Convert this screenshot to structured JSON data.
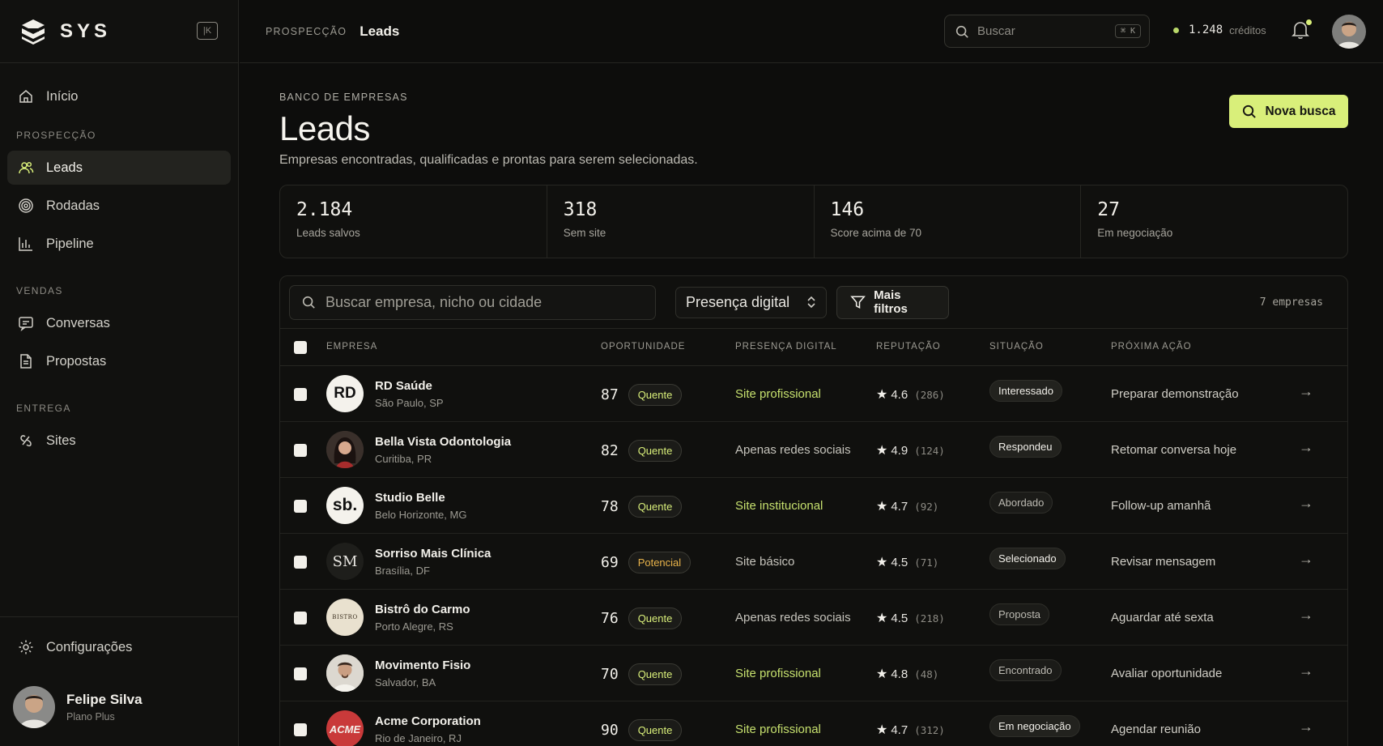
{
  "brand": {
    "name": "SYS"
  },
  "sidebar": {
    "home": "Início",
    "sections": [
      {
        "title": "PROSPECÇÃO",
        "items": [
          "Leads",
          "Rodadas",
          "Pipeline"
        ]
      },
      {
        "title": "VENDAS",
        "items": [
          "Conversas",
          "Propostas"
        ]
      },
      {
        "title": "ENTREGA",
        "items": [
          "Sites"
        ]
      }
    ],
    "settings": "Configurações",
    "user": {
      "name": "Felipe Silva",
      "plan": "Plano Plus"
    }
  },
  "topbar": {
    "section": "PROSPECÇÃO",
    "current": "Leads",
    "search_placeholder": "Buscar",
    "shortcut": "⌘ K",
    "credits_value": "1.248",
    "credits_label": "créditos"
  },
  "header": {
    "eyebrow": "BANCO DE EMPRESAS",
    "title": "Leads",
    "subtitle": "Empresas encontradas, qualificadas e prontas para serem selecionadas.",
    "new_button": "Nova busca"
  },
  "stats": [
    {
      "value": "2.184",
      "label": "Leads salvos"
    },
    {
      "value": "318",
      "label": "Sem site"
    },
    {
      "value": "146",
      "label": "Score acima de 70"
    },
    {
      "value": "27",
      "label": "Em negociação"
    }
  ],
  "toolbar": {
    "search_placeholder": "Buscar empresa, nicho ou cidade",
    "select_value": "Presença digital",
    "filters_label": "Mais filtros",
    "count": "7 empresas"
  },
  "table": {
    "headers": [
      "EMPRESA",
      "OPORTUNIDADE",
      "PRESENÇA DIGITAL",
      "REPUTAÇÃO",
      "SITUAÇÃO",
      "PRÓXIMA AÇÃO"
    ],
    "rows": [
      {
        "logo": "RD",
        "name": "RD Saúde",
        "city": "São Paulo, SP",
        "score": "87",
        "tier": "Quente",
        "presence": "Site profissional",
        "rating": "4.6",
        "reviews": "(286)",
        "status": "Interessado",
        "next": "Preparar demonstração"
      },
      {
        "logo": "",
        "name": "Bella Vista Odontologia",
        "city": "Curitiba, PR",
        "score": "82",
        "tier": "Quente",
        "presence": "Apenas redes sociais",
        "rating": "4.9",
        "reviews": "(124)",
        "status": "Respondeu",
        "next": "Retomar conversa hoje"
      },
      {
        "logo": "sb.",
        "name": "Studio Belle",
        "city": "Belo Horizonte, MG",
        "score": "78",
        "tier": "Quente",
        "presence": "Site institucional",
        "rating": "4.7",
        "reviews": "(92)",
        "status": "Abordado",
        "next": "Follow-up amanhã"
      },
      {
        "logo": "SM",
        "name": "Sorriso Mais Clínica",
        "city": "Brasília, DF",
        "score": "69",
        "tier": "Potencial",
        "presence": "Site básico",
        "rating": "4.5",
        "reviews": "(71)",
        "status": "Selecionado",
        "next": "Revisar mensagem"
      },
      {
        "logo": "BISTRO",
        "name": "Bistrô do Carmo",
        "city": "Porto Alegre, RS",
        "score": "76",
        "tier": "Quente",
        "presence": "Apenas redes sociais",
        "rating": "4.5",
        "reviews": "(218)",
        "status": "Proposta",
        "next": "Aguardar até sexta"
      },
      {
        "logo": "",
        "name": "Movimento Fisio",
        "city": "Salvador, BA",
        "score": "70",
        "tier": "Quente",
        "presence": "Site profissional",
        "rating": "4.8",
        "reviews": "(48)",
        "status": "Encontrado",
        "next": "Avaliar oportunidade"
      },
      {
        "logo": "ACME",
        "name": "Acme Corporation",
        "city": "Rio de Janeiro, RJ",
        "score": "90",
        "tier": "Quente",
        "presence": "Site profissional",
        "rating": "4.7",
        "reviews": "(312)",
        "status": "Em negociação",
        "next": "Agendar reunião"
      }
    ]
  },
  "colors": {
    "accent": "#d9ef7a",
    "background": "#0d0d0c",
    "presence_green": "#c6e06e",
    "potencial": "#e8b34a"
  }
}
